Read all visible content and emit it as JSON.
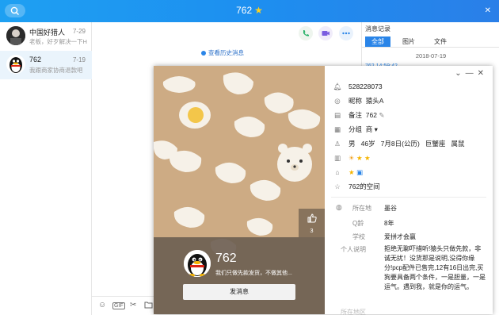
{
  "window": {
    "title": "762",
    "star_icon": "star-icon",
    "search_icon": "search-icon",
    "controls": "—  □  ×"
  },
  "chat_list": [
    {
      "name": "中国好猎人",
      "date": "7-29",
      "preview": "老板，好歹解决一下H",
      "active": false
    },
    {
      "name": "762",
      "date": "7-19",
      "preview": "我跟商家协商退款吧",
      "active": true
    }
  ],
  "chat": {
    "history_link": "查看历史消息",
    "top_icons": [
      "phone-icon",
      "video-icon",
      "more-icon"
    ],
    "toolbar_icons": [
      "emoji-icon",
      "gif-icon",
      "scissors-icon",
      "folder-icon"
    ],
    "toolbar_gif": "GIF"
  },
  "history_panel": {
    "title": "消息记录",
    "tabs": [
      "全部",
      "图片",
      "文件"
    ],
    "date": "2018-07-19",
    "partial_time": "762 14:59:42"
  },
  "profile": {
    "name": "762",
    "signature": "我们只做先款发货，不做其他...",
    "send_button": "发消息",
    "like_count": "3",
    "qq_number": "528228073",
    "nickname_label": "昵称",
    "nickname": "猿头A",
    "remark_label": "备注",
    "remark": "762",
    "group_label": "分组",
    "group": "商",
    "gender": "男",
    "age": "46岁",
    "birthday": "7月8日(公历)",
    "zodiac": "巨蟹座",
    "animal": "属鼠",
    "space": "762的空间",
    "location_label": "所在地",
    "location": "墨谷",
    "q_age_label": "Q龄",
    "q_age": "8年",
    "school_label": "学校",
    "school": "爱拼才会赢",
    "bio_label": "个人说明",
    "bio": "拒绝无聊吓措听!猿头只做先款，非诚无扰！没货那是说明,没得你缘分!pcp配件已售完,12有16日出完,买狗要具备两个条件，一是胆量，一是运气。遇到我，就是你的运气。",
    "partial_label": "所在地区"
  },
  "colors": {
    "topbar": "#1d8ff0",
    "accent": "#2a85e8",
    "cover_bg": "#ccab84"
  }
}
